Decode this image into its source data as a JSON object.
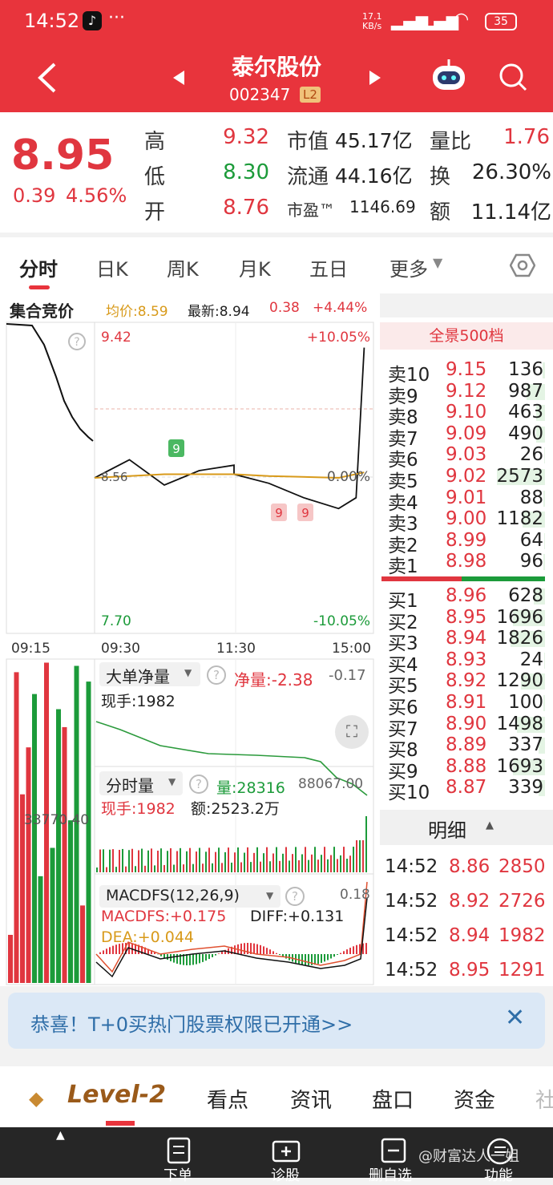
{
  "status": {
    "time": "14:52",
    "speed": "17.1\nKB/s",
    "battery": "35"
  },
  "header": {
    "name": "泰尔股份",
    "code": "002347",
    "badge": "L2"
  },
  "quote": {
    "price": "8.95",
    "change": "0.39",
    "change_pct": "4.56%",
    "high_label": "高",
    "high": "9.32",
    "low_label": "低",
    "low": "8.30",
    "open_label": "开",
    "open": "8.76",
    "mcap_label": "市值",
    "mcap": "45.17亿",
    "float_label": "流通",
    "float": "44.16亿",
    "pe_label": "市盈™",
    "pe": "1146.69",
    "vr_label": "量比",
    "vr": "1.76",
    "turnover_label": "换",
    "turnover": "26.30%",
    "amount_label": "额",
    "amount": "11.14亿"
  },
  "tabs": [
    "分时",
    "日K",
    "周K",
    "月K",
    "五日",
    "更多"
  ],
  "info_line": {
    "auction": "集合竞价",
    "avg": "均价:8.59",
    "latest": "最新:8.94",
    "chg": "0.38",
    "pct": "+4.44%"
  },
  "chart": {
    "y_high": "9.42",
    "y_low": "7.70",
    "pct_high": "+10.05%",
    "pct_low": "-10.05%",
    "zero": "0.00%",
    "mid": "8.56",
    "times": [
      "09:15",
      "09:30",
      "11:30",
      "15:00"
    ],
    "markers": [
      "9",
      "9",
      "9"
    ]
  },
  "chart_data": {
    "type": "line",
    "title": "",
    "xlabel": "",
    "ylabel": "",
    "ylim": [
      7.7,
      9.42
    ],
    "series": [
      {
        "name": "",
        "x": [
          "09:30",
          "10:00",
          "10:30",
          "11:00",
          "11:30",
          "13:00",
          "13:30",
          "14:00",
          "14:30",
          "14:45",
          "14:52"
        ],
        "values": [
          8.56,
          8.66,
          8.52,
          8.6,
          8.63,
          8.58,
          8.53,
          8.45,
          8.39,
          8.45,
          9.28
        ]
      },
      {
        "name": "均价",
        "x": [
          "09:30",
          "10:30",
          "11:30",
          "13:30",
          "14:30",
          "14:52"
        ],
        "values": [
          8.56,
          8.58,
          8.58,
          8.57,
          8.56,
          8.59
        ]
      }
    ]
  },
  "big_order": {
    "title": "大单净量",
    "net_label": "净量:-2.38",
    "net_right": "-0.17",
    "hand_label": "现手:1982"
  },
  "volume": {
    "title": "分时量",
    "vol": "量:28316",
    "max": "88067.00",
    "hand": "现手:1982",
    "amt": "额:2523.2万",
    "auction_vol": "33770.40"
  },
  "macd": {
    "title": "MACDFS(12,26,9)",
    "val": "MACDFS:+0.175",
    "diff": "DIFF:+0.131",
    "dea": "DEA:+0.044",
    "max": "0.18"
  },
  "orderbook": {
    "title": "全景500档",
    "sells": [
      {
        "label": "卖10",
        "price": "9.15",
        "vol": "136",
        "bar": 0.05
      },
      {
        "label": "卖9",
        "price": "9.12",
        "vol": "987",
        "bar": 0.38
      },
      {
        "label": "卖8",
        "price": "9.10",
        "vol": "463",
        "bar": 0.18
      },
      {
        "label": "卖7",
        "price": "9.09",
        "vol": "490",
        "bar": 0.19
      },
      {
        "label": "卖6",
        "price": "9.03",
        "vol": "26",
        "bar": 0.01
      },
      {
        "label": "卖5",
        "price": "9.02",
        "vol": "2573",
        "bar": 1.0
      },
      {
        "label": "卖4",
        "price": "9.01",
        "vol": "88",
        "bar": 0.03
      },
      {
        "label": "卖3",
        "price": "9.00",
        "vol": "1182",
        "bar": 0.46
      },
      {
        "label": "卖2",
        "price": "8.99",
        "vol": "64",
        "bar": 0.02
      },
      {
        "label": "卖1",
        "price": "8.98",
        "vol": "96",
        "bar": 0.04
      }
    ],
    "buys": [
      {
        "label": "买1",
        "price": "8.96",
        "vol": "628",
        "bar": 0.24
      },
      {
        "label": "买2",
        "price": "8.95",
        "vol": "1696",
        "bar": 0.66
      },
      {
        "label": "买3",
        "price": "8.94",
        "vol": "1826",
        "bar": 0.71
      },
      {
        "label": "买4",
        "price": "8.93",
        "vol": "24",
        "bar": 0.01
      },
      {
        "label": "买5",
        "price": "8.92",
        "vol": "1290",
        "bar": 0.5
      },
      {
        "label": "买6",
        "price": "8.91",
        "vol": "100",
        "bar": 0.04
      },
      {
        "label": "买7",
        "price": "8.90",
        "vol": "1498",
        "bar": 0.58
      },
      {
        "label": "买8",
        "price": "8.89",
        "vol": "337",
        "bar": 0.13
      },
      {
        "label": "买9",
        "price": "8.88",
        "vol": "1693",
        "bar": 0.66
      },
      {
        "label": "买10",
        "price": "8.87",
        "vol": "339",
        "bar": 0.13
      }
    ]
  },
  "details": {
    "title": "明细",
    "rows": [
      {
        "time": "14:52",
        "price": "8.86",
        "vol": "2850"
      },
      {
        "time": "14:52",
        "price": "8.92",
        "vol": "2726"
      },
      {
        "time": "14:52",
        "price": "8.94",
        "vol": "1982"
      },
      {
        "time": "14:52",
        "price": "8.95",
        "vol": "1291"
      }
    ]
  },
  "banner": {
    "text": "恭喜！T+0买热门股票权限已开通>>"
  },
  "bottom_tabs": {
    "level2": "Level-2",
    "items": [
      "看点",
      "资讯",
      "盘口",
      "资金",
      "社"
    ]
  },
  "nav": {
    "items": [
      "下单",
      "诊股",
      "删自选",
      "功能"
    ],
    "watermark": "@财富达人一姐"
  },
  "colors": {
    "red": "#e8343c",
    "green": "#1c9b3a",
    "gold": "#d89a1a"
  }
}
